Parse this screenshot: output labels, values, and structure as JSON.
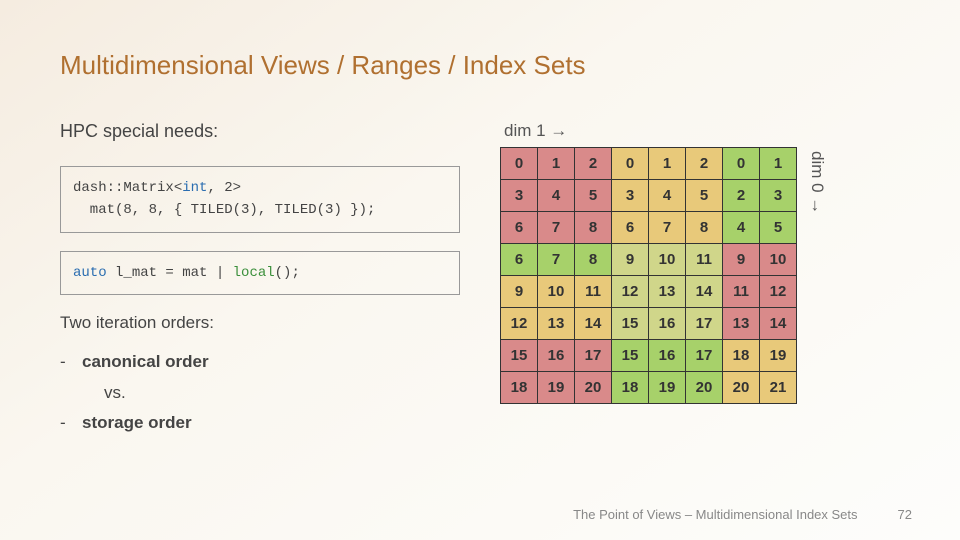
{
  "title": "Multidimensional Views / Ranges / Index Sets",
  "subhead": "HPC special needs:",
  "code1": {
    "l1a": "dash::Matrix<",
    "l1b": "int",
    "l1c": ", 2>",
    "l2": "  mat(8, 8, { TILED(3), TILED(3) });"
  },
  "code2": {
    "a": "auto",
    "b": " l_mat = mat | ",
    "c": "local",
    "d": "();"
  },
  "sect": "Two iteration orders:",
  "bullets": {
    "dash": "-",
    "b1": "canonical order",
    "vs": "vs.",
    "b2": "storage order"
  },
  "dim1": "dim 1 →",
  "dim0": "dim 0 →",
  "matrix": {
    "rows": [
      [
        {
          "v": "0",
          "c": 0
        },
        {
          "v": "1",
          "c": 0
        },
        {
          "v": "2",
          "c": 0
        },
        {
          "v": "0",
          "c": 1
        },
        {
          "v": "1",
          "c": 1
        },
        {
          "v": "2",
          "c": 1
        },
        {
          "v": "0",
          "c": 2
        },
        {
          "v": "1",
          "c": 2
        }
      ],
      [
        {
          "v": "3",
          "c": 0
        },
        {
          "v": "4",
          "c": 0
        },
        {
          "v": "5",
          "c": 0
        },
        {
          "v": "3",
          "c": 1
        },
        {
          "v": "4",
          "c": 1
        },
        {
          "v": "5",
          "c": 1
        },
        {
          "v": "2",
          "c": 2
        },
        {
          "v": "3",
          "c": 2
        }
      ],
      [
        {
          "v": "6",
          "c": 0
        },
        {
          "v": "7",
          "c": 0
        },
        {
          "v": "8",
          "c": 0
        },
        {
          "v": "6",
          "c": 1
        },
        {
          "v": "7",
          "c": 1
        },
        {
          "v": "8",
          "c": 1
        },
        {
          "v": "4",
          "c": 2
        },
        {
          "v": "5",
          "c": 2
        }
      ],
      [
        {
          "v": "6",
          "c": 2
        },
        {
          "v": "7",
          "c": 2
        },
        {
          "v": "8",
          "c": 2
        },
        {
          "v": "9",
          "c": 3
        },
        {
          "v": "10",
          "c": 3
        },
        {
          "v": "11",
          "c": 3
        },
        {
          "v": "9",
          "c": 0
        },
        {
          "v": "10",
          "c": 0
        }
      ],
      [
        {
          "v": "9",
          "c": 1
        },
        {
          "v": "10",
          "c": 1
        },
        {
          "v": "11",
          "c": 1
        },
        {
          "v": "12",
          "c": 3
        },
        {
          "v": "13",
          "c": 3
        },
        {
          "v": "14",
          "c": 3
        },
        {
          "v": "11",
          "c": 0
        },
        {
          "v": "12",
          "c": 0
        }
      ],
      [
        {
          "v": "12",
          "c": 1
        },
        {
          "v": "13",
          "c": 1
        },
        {
          "v": "14",
          "c": 1
        },
        {
          "v": "15",
          "c": 3
        },
        {
          "v": "16",
          "c": 3
        },
        {
          "v": "17",
          "c": 3
        },
        {
          "v": "13",
          "c": 0
        },
        {
          "v": "14",
          "c": 0
        }
      ],
      [
        {
          "v": "15",
          "c": 0
        },
        {
          "v": "16",
          "c": 0
        },
        {
          "v": "17",
          "c": 0
        },
        {
          "v": "15",
          "c": 2
        },
        {
          "v": "16",
          "c": 2
        },
        {
          "v": "17",
          "c": 2
        },
        {
          "v": "18",
          "c": 1
        },
        {
          "v": "19",
          "c": 1
        }
      ],
      [
        {
          "v": "18",
          "c": 0
        },
        {
          "v": "19",
          "c": 0
        },
        {
          "v": "20",
          "c": 0
        },
        {
          "v": "18",
          "c": 2
        },
        {
          "v": "19",
          "c": 2
        },
        {
          "v": "20",
          "c": 2
        },
        {
          "v": "20",
          "c": 1
        },
        {
          "v": "21",
          "c": 1
        }
      ]
    ]
  },
  "footer": {
    "text": "The Point of Views – Multidimensional Index Sets",
    "page": "72"
  }
}
